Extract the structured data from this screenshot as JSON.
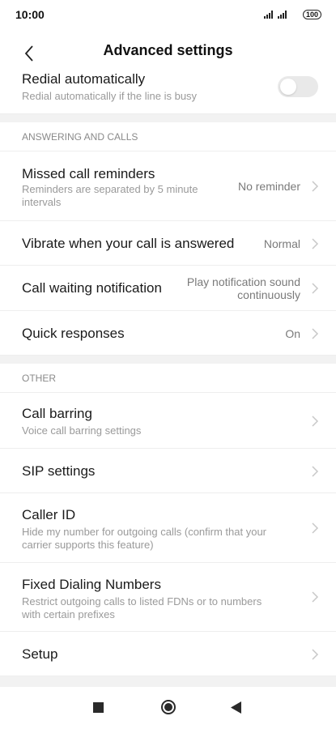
{
  "status_bar": {
    "time": "10:00",
    "battery": "100"
  },
  "header": {
    "title": "Advanced settings"
  },
  "redial": {
    "title": "Redial automatically",
    "subtitle": "Redial automatically if the line is busy",
    "toggle_on": false
  },
  "sections": {
    "answering": {
      "heading": "ANSWERING AND CALLS",
      "items": [
        {
          "title": "Missed call reminders",
          "subtitle_l1": "Reminders are separated by 5 minute",
          "subtitle_l2": "intervals",
          "value": "No reminder"
        },
        {
          "title": "Vibrate when your call is answered",
          "value": "Normal"
        },
        {
          "title": "Call waiting notification",
          "value_l1": "Play notification sound",
          "value_l2": "continuously"
        },
        {
          "title": "Quick responses",
          "value": "On"
        }
      ]
    },
    "other": {
      "heading": "OTHER",
      "items": [
        {
          "title": "Call barring",
          "subtitle": "Voice call barring settings"
        },
        {
          "title": "SIP settings"
        },
        {
          "title": "Caller ID",
          "subtitle_l1": "Hide my number for outgoing calls (confirm that your",
          "subtitle_l2": "carrier supports this feature)"
        },
        {
          "title": "Fixed Dialing Numbers",
          "subtitle_l1": "Restrict outgoing calls to listed FDNs or to numbers",
          "subtitle_l2": "with certain prefixes"
        },
        {
          "title": "Setup"
        }
      ]
    }
  },
  "icons": {
    "back": "chevron-left-icon",
    "row_arrow": "chevron-right-icon",
    "nav_recents": "square-icon",
    "nav_home": "circle-icon",
    "nav_back": "triangle-back-icon"
  }
}
